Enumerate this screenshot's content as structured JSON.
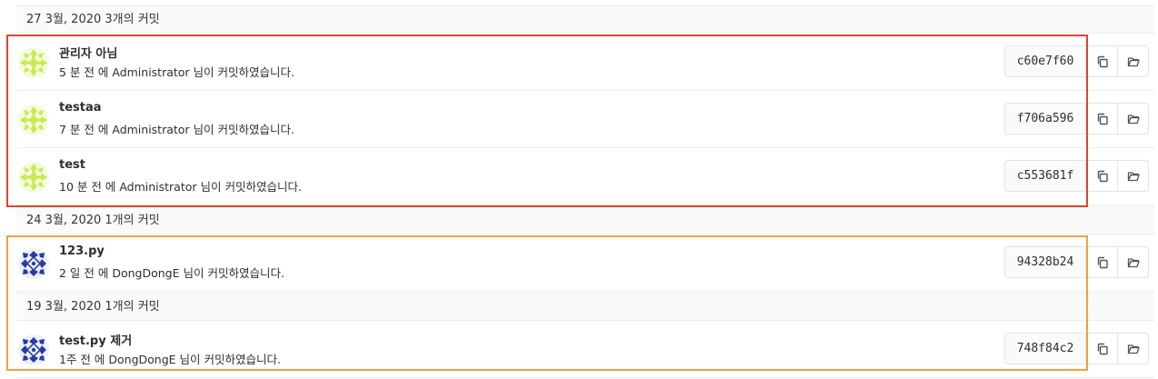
{
  "groups": [
    {
      "header": "27 3월, 2020 3개의 커밋",
      "commits": [
        {
          "title": "관리자 아님",
          "time": "5 분 전",
          "connector": " 에 ",
          "author": "Administrator",
          "suffix": " 님이 커밋하였습니다.",
          "sha": "c60e7f60",
          "avatar": "green-identicon"
        },
        {
          "title": "testaa",
          "time": "7 분 전",
          "connector": " 에 ",
          "author": "Administrator",
          "suffix": " 님이 커밋하였습니다.",
          "sha": "f706a596",
          "avatar": "green-identicon"
        },
        {
          "title": "test",
          "time": "10 분 전",
          "connector": " 에 ",
          "author": "Administrator",
          "suffix": " 님이 커밋하였습니다.",
          "sha": "c553681f",
          "avatar": "green-identicon"
        }
      ]
    },
    {
      "header": "24 3월, 2020 1개의 커밋",
      "commits": [
        {
          "title": "123.py",
          "time": "2 일 전",
          "connector": " 에 ",
          "author": "DongDongE",
          "suffix": " 님이 커밋하였습니다.",
          "sha": "94328b24",
          "avatar": "blue-identicon"
        }
      ]
    },
    {
      "header": "19 3월, 2020 1개의 커밋",
      "commits": [
        {
          "title": "test.py 제거",
          "time": "1주 전",
          "connector": " 에 ",
          "author": "DongDongE",
          "suffix": " 님이 커밋하였습니다.",
          "sha": "748f84c2",
          "avatar": "blue-identicon"
        }
      ]
    }
  ],
  "icons": {
    "copy": "copy-icon",
    "browse": "folder-open-icon"
  },
  "colors": {
    "green_avatar": "#c6ec4a",
    "blue_avatar": "#2a3aa8",
    "highlight_red": "#e0442a",
    "highlight_orange": "#f0a040"
  }
}
